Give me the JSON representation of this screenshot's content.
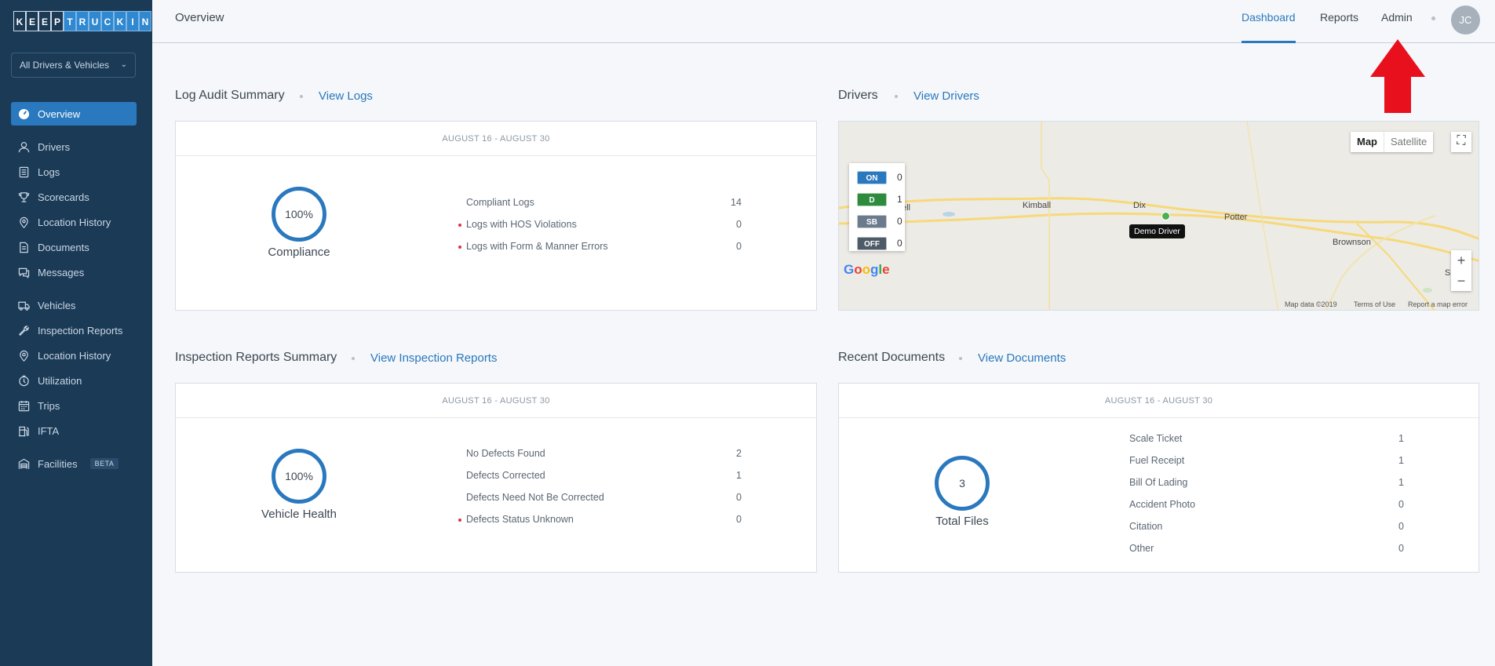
{
  "brand": {
    "letters": [
      "K",
      "E",
      "E",
      "P",
      "T",
      "R",
      "U",
      "C",
      "K",
      "I",
      "N"
    ]
  },
  "sidebar": {
    "filter_label": "All Drivers & Vehicles",
    "items": [
      {
        "label": "Overview"
      },
      {
        "label": "Drivers"
      },
      {
        "label": "Logs"
      },
      {
        "label": "Scorecards"
      },
      {
        "label": "Location History"
      },
      {
        "label": "Documents"
      },
      {
        "label": "Messages"
      },
      {
        "label": "Vehicles"
      },
      {
        "label": "Inspection Reports"
      },
      {
        "label": "Location History"
      },
      {
        "label": "Utilization"
      },
      {
        "label": "Trips"
      },
      {
        "label": "IFTA"
      },
      {
        "label": "Facilities",
        "badge": "BETA"
      }
    ]
  },
  "header": {
    "title": "Overview",
    "nav": {
      "dashboard": "Dashboard",
      "reports": "Reports",
      "admin": "Admin"
    },
    "avatar_initials": "JC"
  },
  "log_audit": {
    "title": "Log Audit Summary",
    "link": "View Logs",
    "date_range": "AUGUST 16  -  AUGUST 30",
    "ring_value": "100%",
    "ring_label": "Compliance",
    "rows": [
      {
        "label": "Compliant Logs",
        "value": "14",
        "flag": false
      },
      {
        "label": "Logs with HOS Violations",
        "value": "0",
        "flag": true
      },
      {
        "label": "Logs with Form & Manner Errors",
        "value": "0",
        "flag": true
      }
    ]
  },
  "drivers": {
    "title": "Drivers",
    "link": "View Drivers",
    "map": {
      "type_map": "Map",
      "type_satellite": "Satellite",
      "statuses": [
        {
          "code": "ON",
          "count": "0",
          "color": "#2a78bd"
        },
        {
          "code": "D",
          "count": "1",
          "color": "#2e8b3e"
        },
        {
          "code": "SB",
          "count": "0",
          "color": "#6b7b8c"
        },
        {
          "code": "OFF",
          "count": "0",
          "color": "#4d5a67"
        }
      ],
      "places": {
        "ell": "ell",
        "kimball": "Kimball",
        "dix": "Dix",
        "potter": "Potter",
        "brownson": "Brownson",
        "sidney": "Sidney"
      },
      "driver_name": "Demo Driver",
      "google": "Google",
      "map_data": "Map data ©2019",
      "terms": "Terms of Use",
      "report": "Report a map error",
      "zoom_in": "+",
      "zoom_out": "−"
    }
  },
  "inspection": {
    "title": "Inspection Reports Summary",
    "link": "View Inspection Reports",
    "date_range": "AUGUST 16  -  AUGUST 30",
    "ring_value": "100%",
    "ring_label": "Vehicle Health",
    "rows": [
      {
        "label": "No Defects Found",
        "value": "2",
        "flag": false
      },
      {
        "label": "Defects Corrected",
        "value": "1",
        "flag": false
      },
      {
        "label": "Defects Need Not Be Corrected",
        "value": "0",
        "flag": false
      },
      {
        "label": "Defects Status Unknown",
        "value": "0",
        "flag": true
      }
    ]
  },
  "documents": {
    "title": "Recent Documents",
    "link": "View Documents",
    "date_range": "AUGUST 16  -  AUGUST 30",
    "ring_value": "3",
    "ring_label": "Total Files",
    "rows": [
      {
        "label": "Scale Ticket",
        "value": "1"
      },
      {
        "label": "Fuel Receipt",
        "value": "1"
      },
      {
        "label": "Bill Of Lading",
        "value": "1"
      },
      {
        "label": "Accident Photo",
        "value": "0"
      },
      {
        "label": "Citation",
        "value": "0"
      },
      {
        "label": "Other",
        "value": "0"
      }
    ]
  },
  "colors": {
    "sidebar": "#1b3a56",
    "accent": "#2a78bd",
    "arrow": "#e8101c"
  }
}
